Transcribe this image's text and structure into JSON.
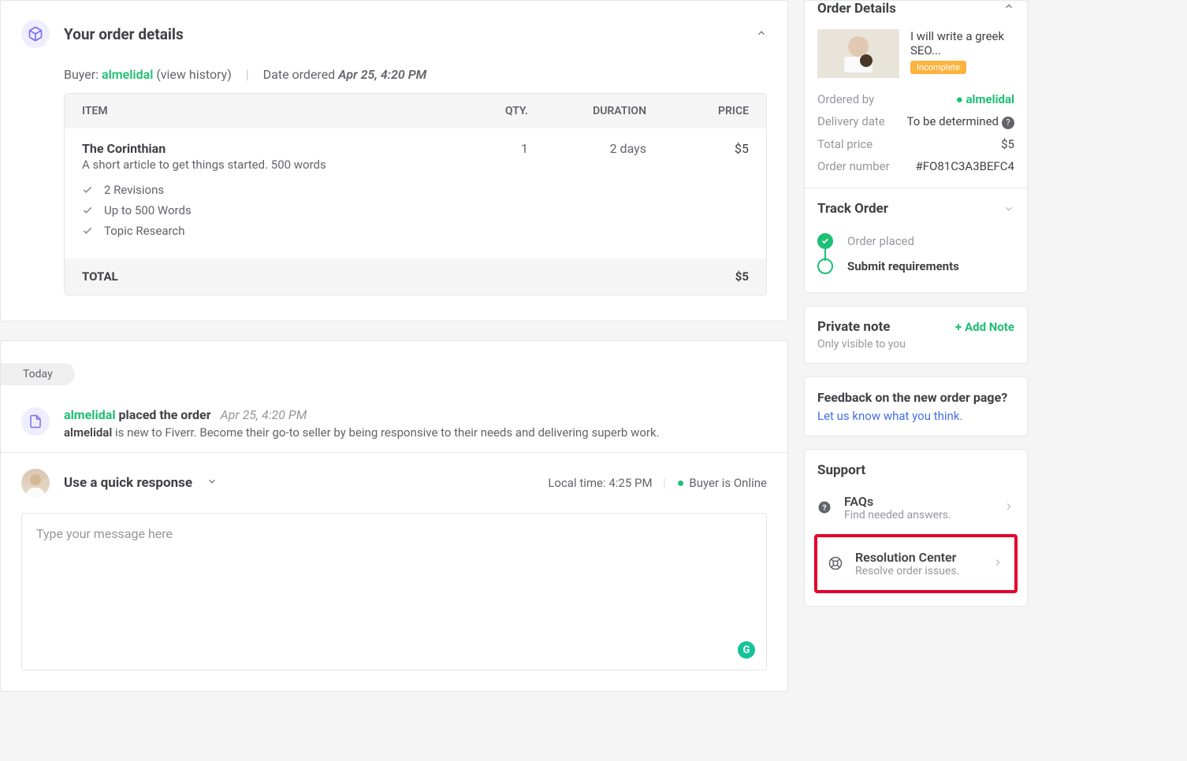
{
  "order": {
    "title": "Your order details",
    "buyer_label": "Buyer:",
    "buyer": "almelidal",
    "view_history": "(view history)",
    "date_label": "Date ordered",
    "date_value": "Apr 25, 4:20 PM",
    "headers": {
      "item": "ITEM",
      "qty": "QTY.",
      "duration": "DURATION",
      "price": "PRICE"
    },
    "item": {
      "name": "The Corinthian",
      "desc": "A short article to get things started. 500 words",
      "features": [
        "2 Revisions",
        "Up to 500 Words",
        "Topic Research"
      ],
      "qty": "1",
      "duration": "2 days",
      "price": "$5"
    },
    "total_label": "TOTAL",
    "total_value": "$5"
  },
  "activity": {
    "today": "Today",
    "buyer": "almelidal",
    "placed": " placed the order",
    "timestamp": "Apr 25, 4:20 PM",
    "new_buyer_name": "almelidal",
    "new_buyer_text": " is new to Fiverr. Become their go-to seller by being responsive to their needs and delivering superb work."
  },
  "reply": {
    "quick_response": "Use a quick response",
    "local_time_label": "Local time:",
    "local_time": "4:25 PM",
    "buyer_status": "Buyer is Online",
    "placeholder": "Type your message here"
  },
  "sidebar": {
    "details_title": "Order Details",
    "gig_title": "I will write a greek SEO...",
    "gig_status": "Incomplete",
    "ordered_by_label": "Ordered by",
    "ordered_by": "almelidal",
    "delivery_label": "Delivery date",
    "delivery_value": "To be determined",
    "total_label": "Total price",
    "total_value": "$5",
    "ordernum_label": "Order number",
    "ordernum_value": "#FO81C3A3BEFC4",
    "track_title": "Track Order",
    "track_step1": "Order placed",
    "track_step2": "Submit requirements",
    "note_title": "Private note",
    "add_note": "Add Note",
    "note_sub": "Only visible to you",
    "feedback_title": "Feedback on the new order page?",
    "feedback_link": "Let us know what you think",
    "support_title": "Support",
    "faqs_title": "FAQs",
    "faqs_sub": "Find needed answers.",
    "res_title": "Resolution Center",
    "res_sub": "Resolve order issues."
  }
}
